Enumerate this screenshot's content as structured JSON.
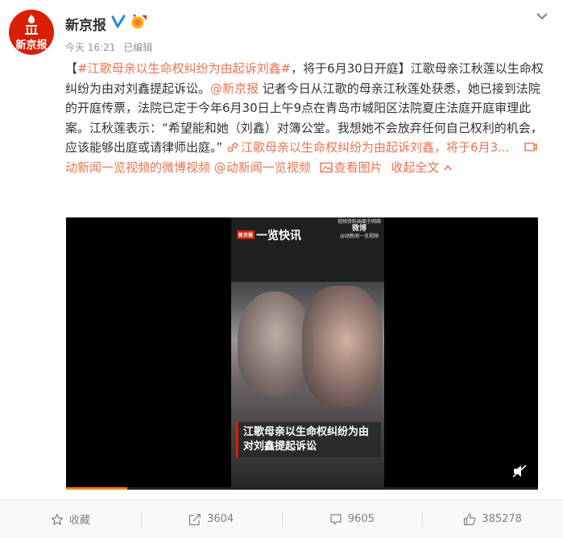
{
  "header": {
    "avatar_text": "新京报",
    "username": "新京报",
    "time": "今天 16:21",
    "edited": "已编辑"
  },
  "post": {
    "open_bracket": "【",
    "tag": "#江歌母亲以生命权纠纷为由起诉刘鑫#",
    "title_rest": "，将于6月30日开庭】江歌母亲江秋莲以生命权纠纷为由对刘鑫提起诉讼。",
    "mention": "@新京报",
    "body": " 记者今日从江歌的母亲江秋莲处获悉，她已接到法院的开庭传票，法院已定于今年6月30日上午9点在青岛市城阳区法院夏庄法庭开庭审理此案。江秋莲表示：“希望能和她（刘鑫）对簿公堂。我想她不会放弃任何自己权利的机会，应该能够出庭或请律师出庭。” ",
    "link_title": "江歌母亲以生命权纠纷为由起诉刘鑫，将于6月3...",
    "video_link": "动新闻一览视频的微博视频",
    "mention2": "@动新闻一览视频",
    "view_images": "查看图片",
    "collapse": "收起全文"
  },
  "video": {
    "badge": "新京报",
    "brand": "一览快讯",
    "watermark_line1": "视频资料画面于网络",
    "watermark_weibo": "微博",
    "watermark_line2": "@动新闻一览视频",
    "caption": "江歌母亲以生命权纠纷为由对刘鑫提起诉讼",
    "progress": 0.13
  },
  "actions": [
    {
      "icon": "star-icon",
      "label": "收藏"
    },
    {
      "icon": "share-icon",
      "label": "3604"
    },
    {
      "icon": "comment-icon",
      "label": "9605"
    },
    {
      "icon": "like-icon",
      "label": "385278"
    }
  ],
  "colors": {
    "link": "#eb7350",
    "brand_red": "#d81e06",
    "progress": "#ff8200"
  }
}
